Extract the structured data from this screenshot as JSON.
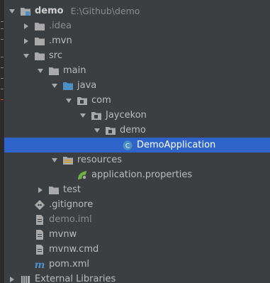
{
  "project_tree": {
    "root": {
      "name": "demo",
      "path": "E:\\Github\\demo"
    },
    "nodes": [
      {
        "label": ".idea"
      },
      {
        "label": ".mvn"
      },
      {
        "label": "src"
      },
      {
        "label": "main"
      },
      {
        "label": "java"
      },
      {
        "label": "com"
      },
      {
        "label": "Jaycekon"
      },
      {
        "label": "demo"
      },
      {
        "label": "DemoApplication"
      },
      {
        "label": "resources"
      },
      {
        "label": "application.properties"
      },
      {
        "label": "test"
      },
      {
        "label": ".gitignore"
      },
      {
        "label": "demo.iml"
      },
      {
        "label": "mvnw"
      },
      {
        "label": "mvnw.cmd"
      },
      {
        "label": "pom.xml"
      },
      {
        "label": "External Libraries"
      }
    ]
  },
  "icons": {
    "root": "project-module-icon",
    "folder": "folder-icon",
    "source_folder": "source-folder-icon",
    "package": "package-icon",
    "resources_folder": "resources-folder-icon",
    "spring_class": "spring-boot-class-icon",
    "properties_file": "spring-properties-icon",
    "git_file": "gitignore-file-icon",
    "text_file": "file-icon",
    "maven_file": "maven-pom-icon",
    "libraries": "external-libraries-icon"
  },
  "colors": {
    "background": "#3c3f41",
    "selection": "#2f65ca",
    "text": "#bbbbbb",
    "muted_text": "#8c8c8c",
    "folder": "#a9a9a9",
    "source_folder": "#4b8fc7",
    "spring_green": "#6db33f"
  }
}
